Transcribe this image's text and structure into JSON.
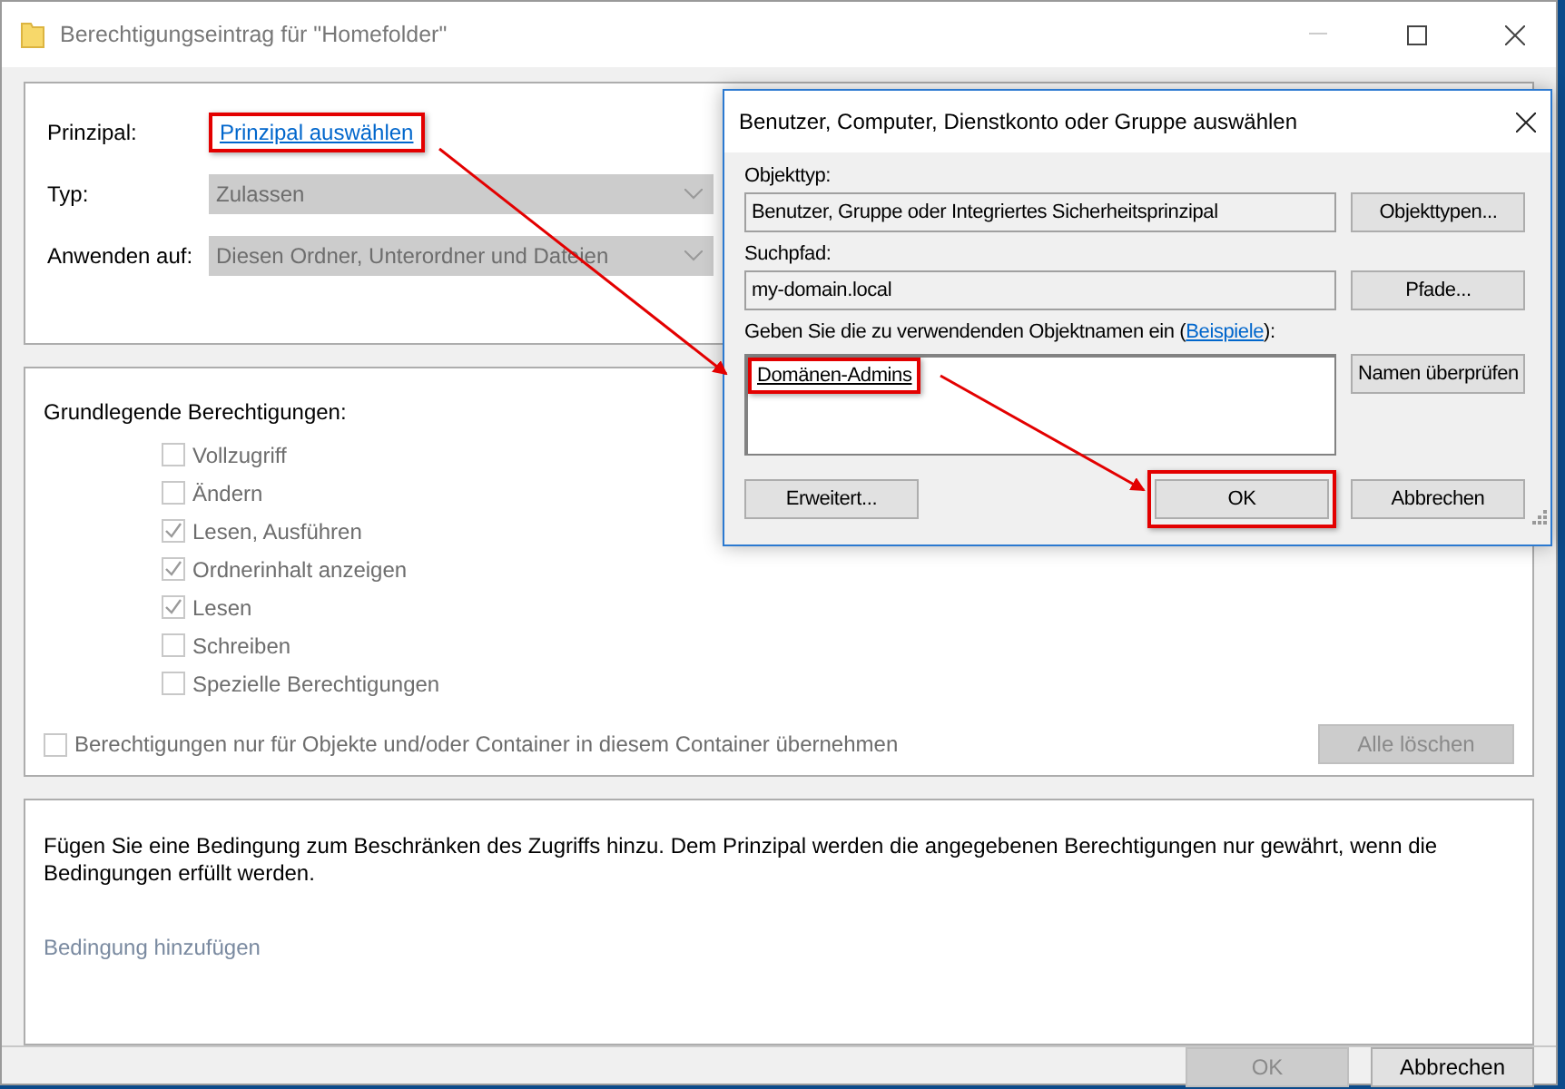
{
  "window": {
    "title": "Berechtigungseintrag für \"Homefolder\""
  },
  "principal": {
    "label": "Prinzipal:",
    "link": "Prinzipal auswählen",
    "highlighted": true
  },
  "type": {
    "label": "Typ:",
    "value": "Zulassen",
    "disabled": true
  },
  "applies_to": {
    "label": "Anwenden auf:",
    "value": "Diesen Ordner, Unterordner und Dateien",
    "disabled": true
  },
  "permissions": {
    "heading": "Grundlegende Berechtigungen:",
    "items": [
      {
        "label": "Vollzugriff",
        "checked": false,
        "disabled": true
      },
      {
        "label": "Ändern",
        "checked": false,
        "disabled": true
      },
      {
        "label": "Lesen, Ausführen",
        "checked": true,
        "disabled": true
      },
      {
        "label": "Ordnerinhalt anzeigen",
        "checked": true,
        "disabled": true
      },
      {
        "label": "Lesen",
        "checked": true,
        "disabled": true
      },
      {
        "label": "Schreiben",
        "checked": false,
        "disabled": true
      },
      {
        "label": "Spezielle Berechtigungen",
        "checked": false,
        "disabled": true
      }
    ],
    "inherit_only": {
      "label": "Berechtigungen nur für Objekte und/oder Container in diesem Container übernehmen",
      "checked": false
    },
    "clear_button": {
      "label": "Alle löschen",
      "disabled": true
    }
  },
  "condition": {
    "text": "Fügen Sie eine Bedingung zum Beschränken des Zugriffs hinzu. Dem Prinzipal werden die angegebenen Berechtigungen nur gewährt, wenn die Bedingungen erfüllt werden.",
    "add_link": "Bedingung hinzufügen"
  },
  "footer_buttons": [
    {
      "label": "OK",
      "disabled": true
    },
    {
      "label": "Abbrechen",
      "disabled": false
    }
  ],
  "select_dialog": {
    "title": "Benutzer, Computer, Dienstkonto oder Gruppe auswählen",
    "object_type": {
      "label": "Objekttyp:",
      "value": "Benutzer, Gruppe oder Integriertes Sicherheitsprinzipal",
      "button": "Objekttypen..."
    },
    "search_path": {
      "label": "Suchpfad:",
      "value": "my-domain.local",
      "button": "Pfade..."
    },
    "names": {
      "label_before": "Geben Sie die zu verwendenden Objektnamen ein (",
      "link": "Beispiele",
      "label_after": "):",
      "value": "Domänen-Admins",
      "highlighted": true,
      "button": "Namen überprüfen"
    },
    "buttons": [
      {
        "label": "Erweitert...",
        "highlighted": false
      },
      {
        "label": "OK",
        "highlighted": true
      },
      {
        "label": "Abbrechen",
        "highlighted": false
      }
    ]
  }
}
